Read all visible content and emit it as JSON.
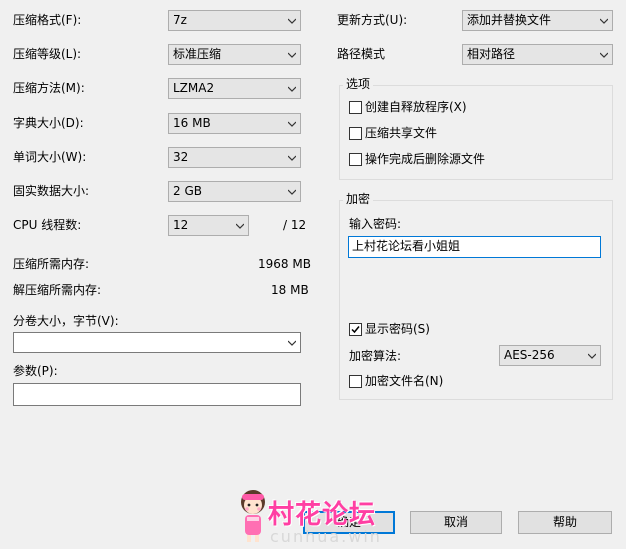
{
  "left": {
    "format_label": "压缩格式(F):",
    "format_value": "7z",
    "level_label": "压缩等级(L):",
    "level_value": "标准压缩",
    "method_label": "压缩方法(M):",
    "method_value": "LZMA2",
    "dict_label": "字典大小(D):",
    "dict_value": "16 MB",
    "word_label": "单词大小(W):",
    "word_value": "32",
    "solid_label": "固实数据大小:",
    "solid_value": "2 GB",
    "threads_label": "CPU 线程数:",
    "threads_value": "12",
    "threads_max": "/ 12",
    "mem_compress_label": "压缩所需内存:",
    "mem_compress_value": "1968 MB",
    "mem_decompress_label": "解压缩所需内存:",
    "mem_decompress_value": "18 MB",
    "split_label": "分卷大小，字节(V):",
    "split_value": "",
    "params_label": "参数(P):",
    "params_value": ""
  },
  "right": {
    "update_label": "更新方式(U):",
    "update_value": "添加并替换文件",
    "path_label": "路径模式",
    "path_value": "相对路径",
    "options_title": "选项",
    "opt_sfx": "创建自释放程序(X)",
    "opt_shared": "压缩共享文件",
    "opt_delete": "操作完成后删除源文件",
    "encrypt_title": "加密",
    "password_label": "输入密码:",
    "password_value": "上村花论坛看小姐姐",
    "show_password": "显示密码(S)",
    "enc_method_label": "加密算法:",
    "enc_method_value": "AES-256",
    "enc_names": "加密文件名(N)"
  },
  "buttons": {
    "ok": "确定",
    "cancel": "取消",
    "help": "帮助"
  },
  "watermark": {
    "text": "村花论坛",
    "sub": "cunhua.win"
  },
  "state": {
    "opt_sfx_checked": false,
    "opt_shared_checked": false,
    "opt_delete_checked": false,
    "show_password_checked": true,
    "enc_names_checked": false
  }
}
